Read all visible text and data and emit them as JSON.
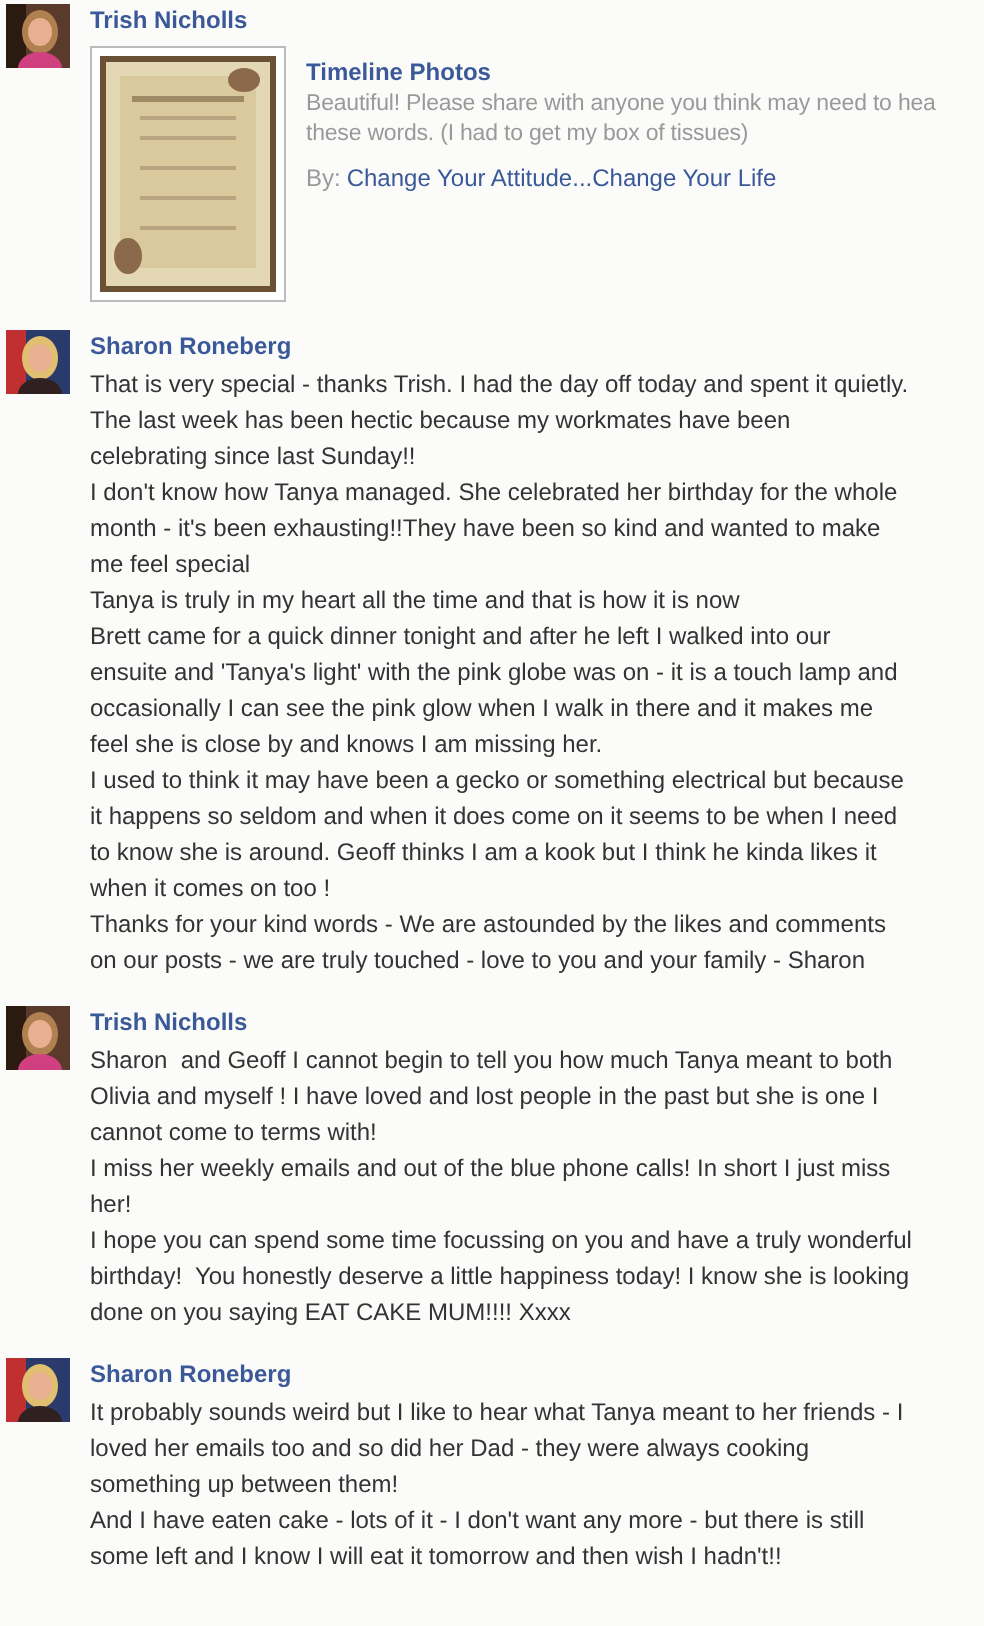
{
  "posts": [
    {
      "author": "Trish Nicholls",
      "avatar": {
        "kind": "picture"
      },
      "attachment": {
        "title": "Timeline Photos",
        "description_lines": [
          "Beautiful! Please share with anyone you think may need to hea",
          "these words. (I had to get my box of tissues)"
        ],
        "by_label": "By:",
        "by_link": "Change Your Attitude...Change Your Life"
      }
    },
    {
      "author": "Sharon Roneberg",
      "avatar": {
        "kind": "picture"
      },
      "paragraphs": [
        "That is very special - thanks Trish. I had the day off today and spent it quietly. The last week has been hectic because my workmates have been celebrating since last Sunday!!",
        "I don't know how Tanya managed. She celebrated her birthday for the whole month - it's been exhausting!!They have been so kind and wanted to make me feel special",
        "Tanya is truly in my heart all the time and that is how it is now",
        "Brett came for a quick dinner tonight and after he left I walked into our ensuite and 'Tanya's light' with the pink globe was on - it is a touch lamp and occasionally I can see the pink glow when I walk in there and it makes me feel she is close by and knows I am missing her.",
        "I used to think it may have been a gecko or something electrical but because it happens so seldom and when it does come on it seems to be when I need to know she is around. Geoff thinks I am a kook but I think he kinda likes it when it comes on too !",
        "Thanks for your kind words - We are astounded by the likes and comments on our posts - we are truly touched - love to you and your family - Sharon"
      ]
    },
    {
      "author": "Trish Nicholls",
      "avatar": {
        "kind": "picture"
      },
      "paragraphs": [
        "Sharon  and Geoff I cannot begin to tell you how much Tanya meant to both Olivia and myself ! I have loved and lost people in the past but she is one I cannot come to terms with!",
        "I miss her weekly emails and out of the blue phone calls! In short I just miss her!",
        "I hope you can spend some time focussing on you and have a truly wonderful birthday!  You honestly deserve a little happiness today! I know she is looking done on you saying EAT CAKE MUM!!!! Xxxx"
      ]
    },
    {
      "author": "Sharon Roneberg",
      "avatar": {
        "kind": "picture"
      },
      "paragraphs": [
        "It probably sounds weird but I like to hear what Tanya meant to her friends - I loved her emails too and so did her Dad - they were always cooking something up between them!",
        "And I have eaten cake - lots of it - I don't want any more - but there is still some left and I know I will eat it tomorrow and then wish I hadn't!!"
      ]
    }
  ]
}
